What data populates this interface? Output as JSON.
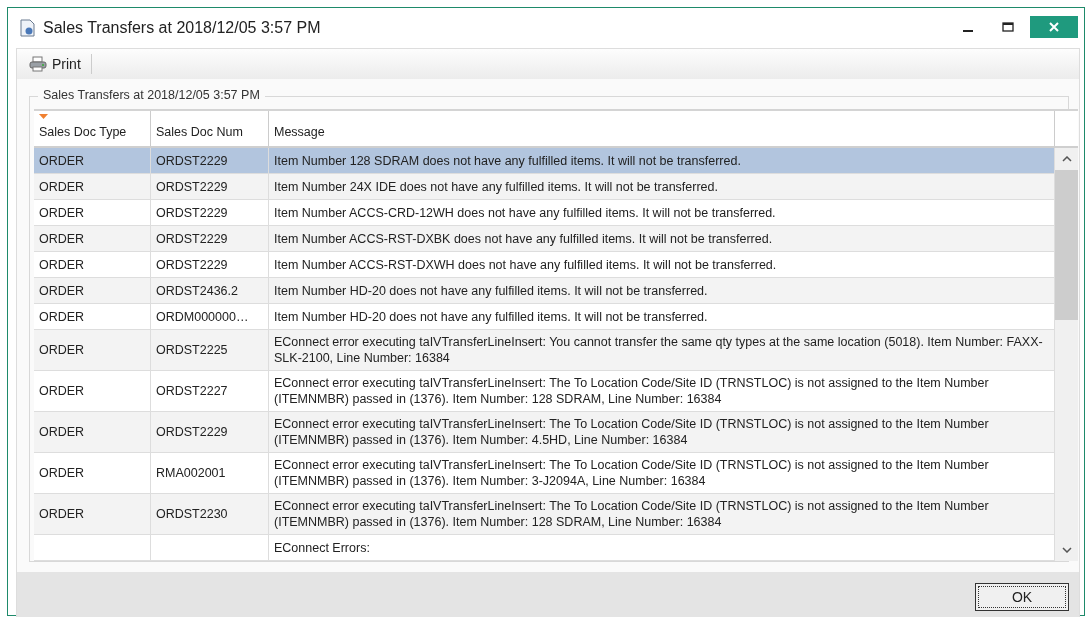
{
  "window": {
    "title": "Sales Transfers at 2018/12/05 3:57 PM"
  },
  "toolbar": {
    "print_label": "Print"
  },
  "group": {
    "title": "Sales Transfers at 2018/12/05 3:57 PM"
  },
  "table": {
    "columns": [
      "Sales Doc Type",
      "Sales Doc Num",
      "Message"
    ],
    "rows": [
      {
        "selected": true,
        "cells": [
          "ORDER",
          "ORDST2229",
          "Item Number 128 SDRAM does not have any fulfilled items.  It will not be transferred."
        ]
      },
      {
        "selected": false,
        "cells": [
          "ORDER",
          "ORDST2229",
          "Item Number 24X IDE does not have any fulfilled items.  It will not be transferred."
        ]
      },
      {
        "selected": false,
        "cells": [
          "ORDER",
          "ORDST2229",
          "Item Number ACCS-CRD-12WH does not have any fulfilled items.  It will not be transferred."
        ]
      },
      {
        "selected": false,
        "cells": [
          "ORDER",
          "ORDST2229",
          "Item Number ACCS-RST-DXBK does not have any fulfilled items.  It will not be transferred."
        ]
      },
      {
        "selected": false,
        "cells": [
          "ORDER",
          "ORDST2229",
          "Item Number ACCS-RST-DXWH does not have any fulfilled items.  It will not be transferred."
        ]
      },
      {
        "selected": false,
        "cells": [
          "ORDER",
          "ORDST2436.2",
          "Item Number HD-20 does not have any fulfilled items.  It will not be transferred."
        ]
      },
      {
        "selected": false,
        "cells": [
          "ORDER",
          "ORDM000000…",
          "Item Number HD-20 does not have any fulfilled items.  It will not be transferred."
        ]
      },
      {
        "selected": false,
        "cells": [
          "ORDER",
          "ORDST2225",
          "EConnect error executing taIVTransferLineInsert: You cannot transfer the same qty types at the same location (5018). Item Number: FAXX-SLK-2100, Line Number: 16384"
        ]
      },
      {
        "selected": false,
        "cells": [
          "ORDER",
          "ORDST2227",
          "EConnect error executing taIVTransferLineInsert: The To Location Code/Site ID (TRNSTLOC) is not assigned to the Item Number (ITEMNMBR) passed in (1376). Item Number: 128 SDRAM, Line Number: 16384"
        ]
      },
      {
        "selected": false,
        "cells": [
          "ORDER",
          "ORDST2229",
          "EConnect error executing taIVTransferLineInsert: The To Location Code/Site ID (TRNSTLOC) is not assigned to the Item Number (ITEMNMBR) passed in (1376). Item Number: 4.5HD, Line Number: 16384"
        ]
      },
      {
        "selected": false,
        "cells": [
          "ORDER",
          "RMA002001",
          "EConnect error executing taIVTransferLineInsert: The To Location Code/Site ID (TRNSTLOC) is not assigned to the Item Number (ITEMNMBR) passed in (1376). Item Number: 3-J2094A, Line Number: 16384"
        ]
      },
      {
        "selected": false,
        "cells": [
          "ORDER",
          "ORDST2230",
          "EConnect error executing taIVTransferLineInsert: The To Location Code/Site ID (TRNSTLOC) is not assigned to the Item Number (ITEMNMBR) passed in (1376). Item Number: 128 SDRAM, Line Number: 16384"
        ]
      },
      {
        "selected": false,
        "cells": [
          "",
          "",
          "EConnect Errors:"
        ]
      }
    ]
  },
  "buttons": [
    "OK"
  ]
}
